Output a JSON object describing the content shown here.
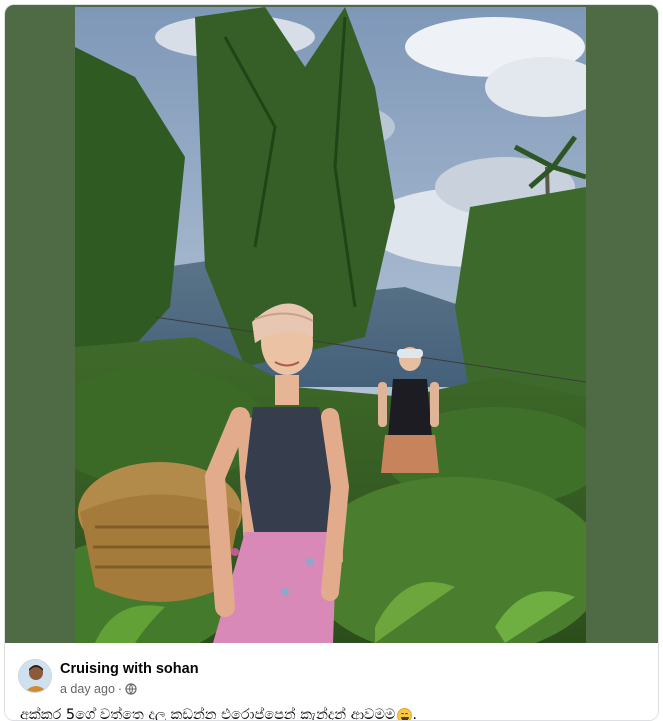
{
  "post": {
    "author_name": "Cruising with sohan",
    "timestamp": "a day ago",
    "separator": "·",
    "privacy_icon": "globe-icon",
    "caption": "අක්කර 5ගේ වත්තෙ දලු කඩන්න එරොප්පෙන් කැන්දන් ආවමම",
    "caption_emoji": "grinning-face-emoji",
    "caption_end": ".",
    "photo_description": "two-women-tea-plantation-photo"
  },
  "colors": {
    "media_background": "#4e6b45",
    "secondary_text": "#65676b",
    "primary_text": "#050505"
  }
}
